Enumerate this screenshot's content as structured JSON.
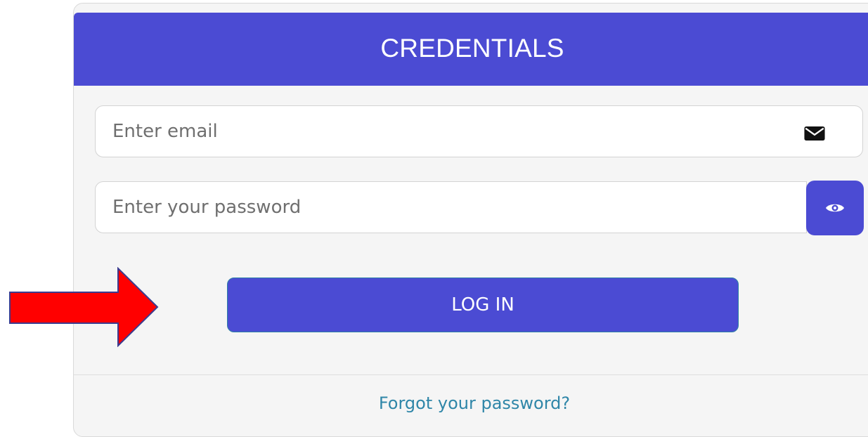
{
  "form": {
    "title": "CREDENTIALS",
    "email_placeholder": "Enter email",
    "password_placeholder": "Enter your password",
    "login_label": "LOG IN",
    "forgot_label": "Forgot your password?"
  },
  "icons": {
    "email": "envelope-icon",
    "password_toggle": "eye-icon",
    "annotation": "red-arrow"
  },
  "colors": {
    "primary": "#4b4bd3",
    "link": "#2f86a8",
    "arrow": "#ff0000"
  }
}
